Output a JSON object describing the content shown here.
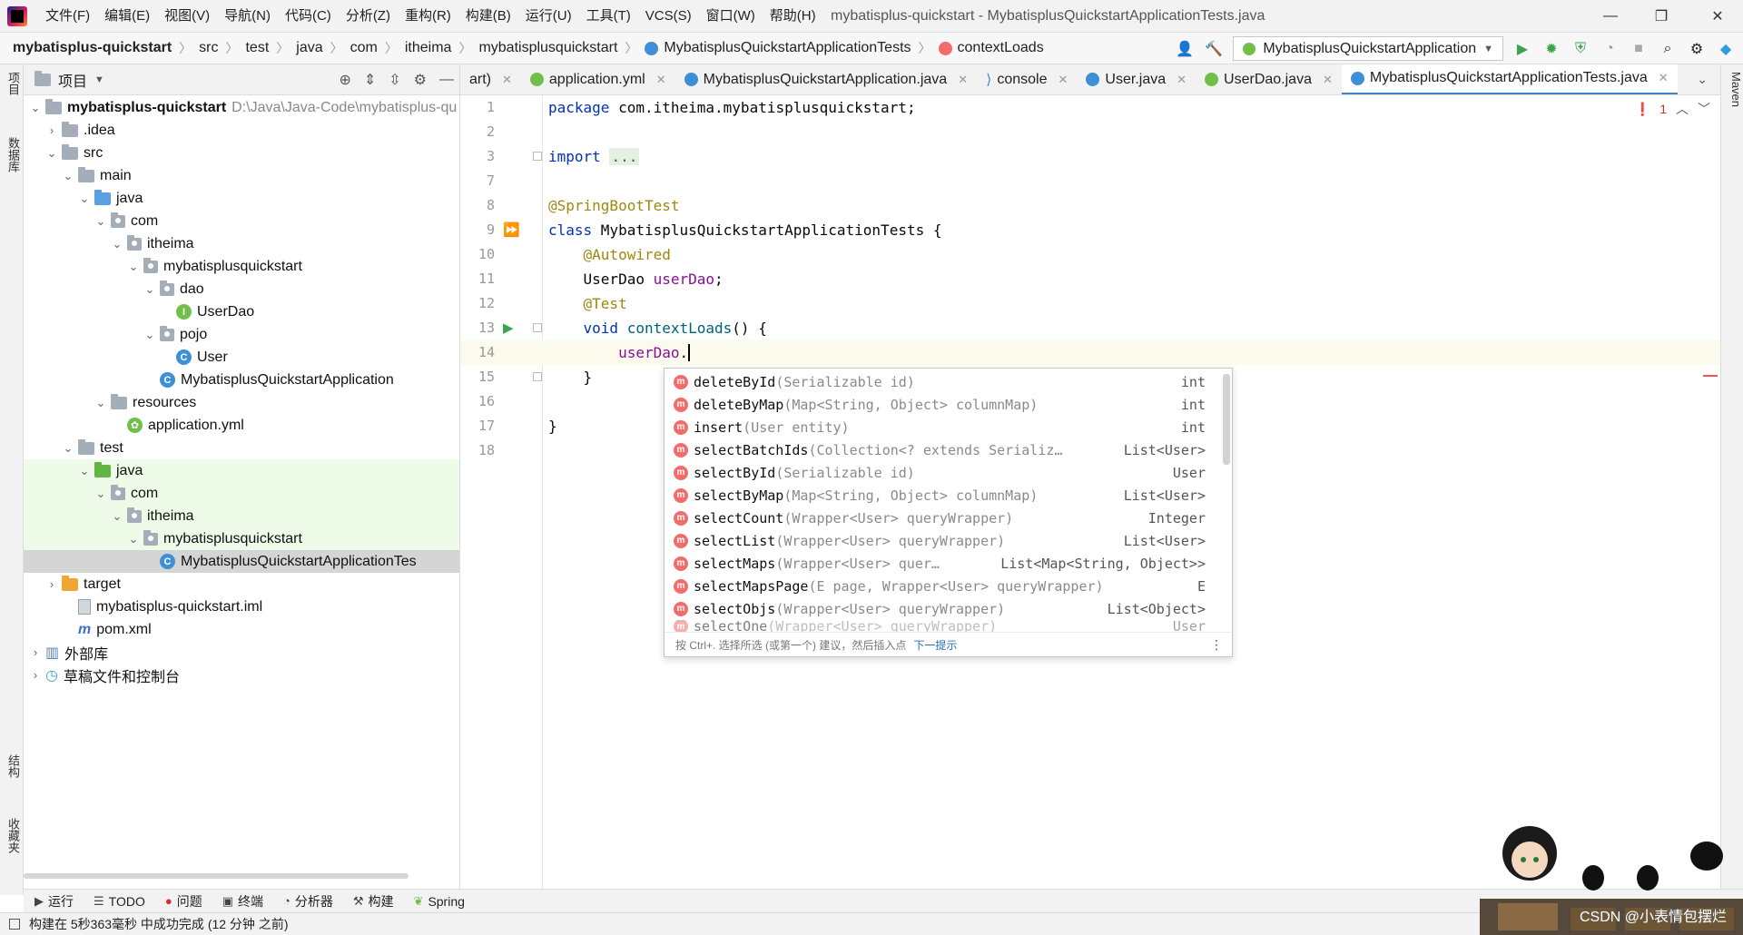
{
  "window": {
    "title": "mybatisplus-quickstart - MybatisplusQuickstartApplicationTests.java",
    "minimize": "—",
    "restore": "❐",
    "close": "✕"
  },
  "menu": [
    "文件(F)",
    "编辑(E)",
    "视图(V)",
    "导航(N)",
    "代码(C)",
    "分析(Z)",
    "重构(R)",
    "构建(B)",
    "运行(U)",
    "工具(T)",
    "VCS(S)",
    "窗口(W)",
    "帮助(H)"
  ],
  "breadcrumb": [
    "mybatisplus-quickstart",
    "src",
    "test",
    "java",
    "com",
    "itheima",
    "mybatisplusquickstart",
    "MybatisplusQuickstartApplicationTests",
    "contextLoads"
  ],
  "toolbar": {
    "run_config": "MybatisplusQuickstartApplication"
  },
  "left_stripe": {
    "project_tab": "项目",
    "database_tab": "数据库",
    "structure_tab": "结构",
    "favorites_tab": "收藏夹"
  },
  "project_panel": {
    "title": "项目",
    "tree": [
      {
        "label": "mybatisplus-quickstart",
        "path": "D:\\Java\\Java-Code\\mybatisplus-qu"
      },
      {
        "label": ".idea"
      },
      {
        "label": "src"
      },
      {
        "label": "main"
      },
      {
        "label": "java"
      },
      {
        "label": "com"
      },
      {
        "label": "itheima"
      },
      {
        "label": "mybatisplusquickstart"
      },
      {
        "label": "dao"
      },
      {
        "label": "UserDao"
      },
      {
        "label": "pojo"
      },
      {
        "label": "User"
      },
      {
        "label": "MybatisplusQuickstartApplication"
      },
      {
        "label": "resources"
      },
      {
        "label": "application.yml"
      },
      {
        "label": "test"
      },
      {
        "label": "java"
      },
      {
        "label": "com"
      },
      {
        "label": "itheima"
      },
      {
        "label": "mybatisplusquickstart"
      },
      {
        "label": "MybatisplusQuickstartApplicationTes"
      },
      {
        "label": "target"
      },
      {
        "label": "mybatisplus-quickstart.iml"
      },
      {
        "label": "pom.xml"
      },
      {
        "label": "外部库"
      },
      {
        "label": "草稿文件和控制台"
      }
    ]
  },
  "editor_tabs": [
    {
      "label": "art)"
    },
    {
      "label": "application.yml"
    },
    {
      "label": "MybatisplusQuickstartApplication.java"
    },
    {
      "label": "console"
    },
    {
      "label": "User.java"
    },
    {
      "label": "UserDao.java"
    },
    {
      "label": "MybatisplusQuickstartApplicationTests.java",
      "active": true
    }
  ],
  "right_stripe": {
    "maven": "Maven"
  },
  "editor": {
    "line_numbers": [
      "1",
      "2",
      "3",
      "7",
      "8",
      "9",
      "10",
      "11",
      "12",
      "13",
      "14",
      "15",
      "16",
      "17",
      "18"
    ],
    "code": {
      "l1_kw": "package",
      "l1_rest": " com.itheima.mybatisplusquickstart;",
      "l3_kw": "import",
      "l3_fold": "...",
      "l8_ann": "@SpringBootTest",
      "l9_kw": "class",
      "l9_rest": " MybatisplusQuickstartApplicationTests {",
      "l10_ann": "@Autowired",
      "l11_type": "UserDao ",
      "l11_field": "userDao",
      "l11_end": ";",
      "l12_ann": "@Test",
      "l13_kw": "void",
      "l13_fn": "contextLoads",
      "l13_rest": "() {",
      "l14_field": "userDao",
      "l14_dot": ".",
      "l15": "}",
      "l17": "}"
    },
    "problems_count": "1"
  },
  "completion": {
    "items": [
      {
        "name": "deleteById",
        "params": "(Serializable id)",
        "type": "int"
      },
      {
        "name": "deleteByMap",
        "params": "(Map<String, Object> columnMap)",
        "type": "int"
      },
      {
        "name": "insert",
        "params": "(User entity)",
        "type": "int"
      },
      {
        "name": "selectBatchIds",
        "params": "(Collection<? extends Serializ…",
        "type": "List<User>"
      },
      {
        "name": "selectById",
        "params": "(Serializable id)",
        "type": "User"
      },
      {
        "name": "selectByMap",
        "params": "(Map<String, Object> columnMap)",
        "type": "List<User>"
      },
      {
        "name": "selectCount",
        "params": "(Wrapper<User> queryWrapper)",
        "type": "Integer"
      },
      {
        "name": "selectList",
        "params": "(Wrapper<User> queryWrapper)",
        "type": "List<User>"
      },
      {
        "name": "selectMaps",
        "params": "(Wrapper<User> quer…",
        "type": "List<Map<String, Object>>"
      },
      {
        "name": "selectMapsPage",
        "params": "(E page, Wrapper<User> queryWrapper)",
        "type": "E"
      },
      {
        "name": "selectObjs",
        "params": "(Wrapper<User> queryWrapper)",
        "type": "List<Object>"
      },
      {
        "name": "selectOne",
        "params": "(Wrapper<User> queryWrapper)",
        "type": "User"
      }
    ],
    "footer_hint": "按 Ctrl+. 选择所选 (或第一个) 建议，然后插入点",
    "footer_link": "下一提示"
  },
  "bottom_tools": [
    "运行",
    "TODO",
    "问题",
    "终端",
    "分析器",
    "构建",
    "Spring"
  ],
  "status": "构建在 5秒363毫秒 中成功完成 (12 分钟 之前)",
  "watermark": "CSDN @小表情包摆烂"
}
